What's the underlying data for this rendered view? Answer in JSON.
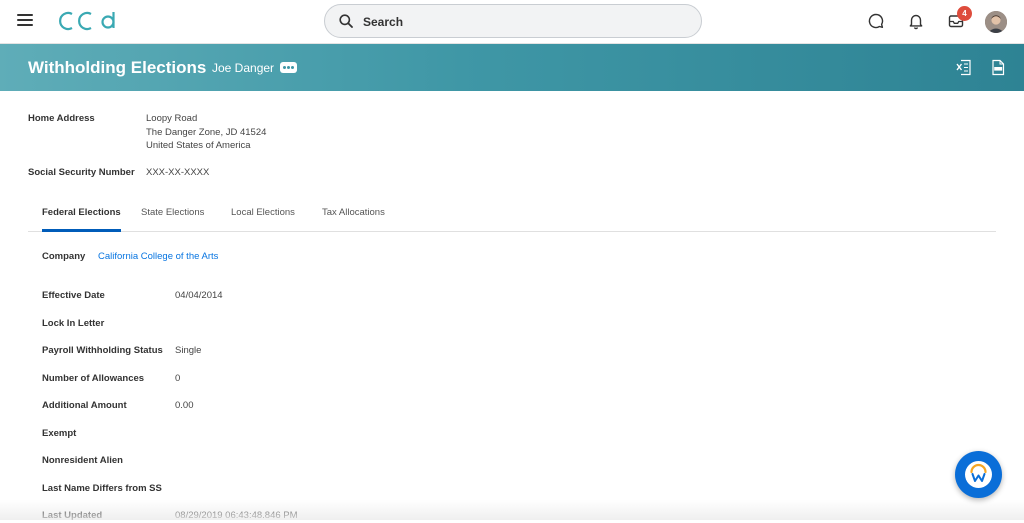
{
  "nav": {
    "logo_text": "CCA",
    "search_placeholder": "Search",
    "inbox_count": "4"
  },
  "header": {
    "title": "Withholding Elections",
    "worker_name": "Joe Danger"
  },
  "profile": {
    "home_address_label": "Home Address",
    "address_line1": "Loopy Road",
    "address_line2": "The Danger Zone, JD 41524",
    "address_line3": "United States of America",
    "ssn_label": "Social Security Number",
    "ssn_value": "XXX-XX-XXXX"
  },
  "tabs": [
    {
      "label": "Federal Elections",
      "active": true
    },
    {
      "label": "State Elections"
    },
    {
      "label": "Local Elections"
    },
    {
      "label": "Tax Allocations"
    }
  ],
  "federal": {
    "company_label": "Company",
    "company_value": "California College of the Arts",
    "fields": [
      {
        "label": "Effective Date",
        "value": "04/04/2014"
      },
      {
        "label": "Lock In Letter",
        "value": ""
      },
      {
        "label": "Payroll Withholding Status",
        "value": "Single"
      },
      {
        "label": "Number of Allowances",
        "value": "0"
      },
      {
        "label": "Additional Amount",
        "value": "0.00"
      },
      {
        "label": "Exempt",
        "value": ""
      },
      {
        "label": "Nonresident Alien",
        "value": ""
      },
      {
        "label": "Last Name Differs from SS",
        "value": ""
      },
      {
        "label": "Last Updated",
        "value": "08/29/2019 06:43:48.846 PM"
      }
    ]
  },
  "icons": {
    "menu": "hamburger-menu-icon",
    "search": "search-icon",
    "chat": "chat-bubble-icon",
    "notifications": "bell-icon",
    "inbox": "inbox-icon",
    "export_excel": "excel-export-icon",
    "export_pdf": "pdf-export-icon",
    "assistant": "workday-assistant-icon"
  },
  "colors": {
    "accent": "#3f97a6",
    "link": "#0875e1",
    "tab_active": "#005cb9",
    "badge": "#de4c3c"
  }
}
